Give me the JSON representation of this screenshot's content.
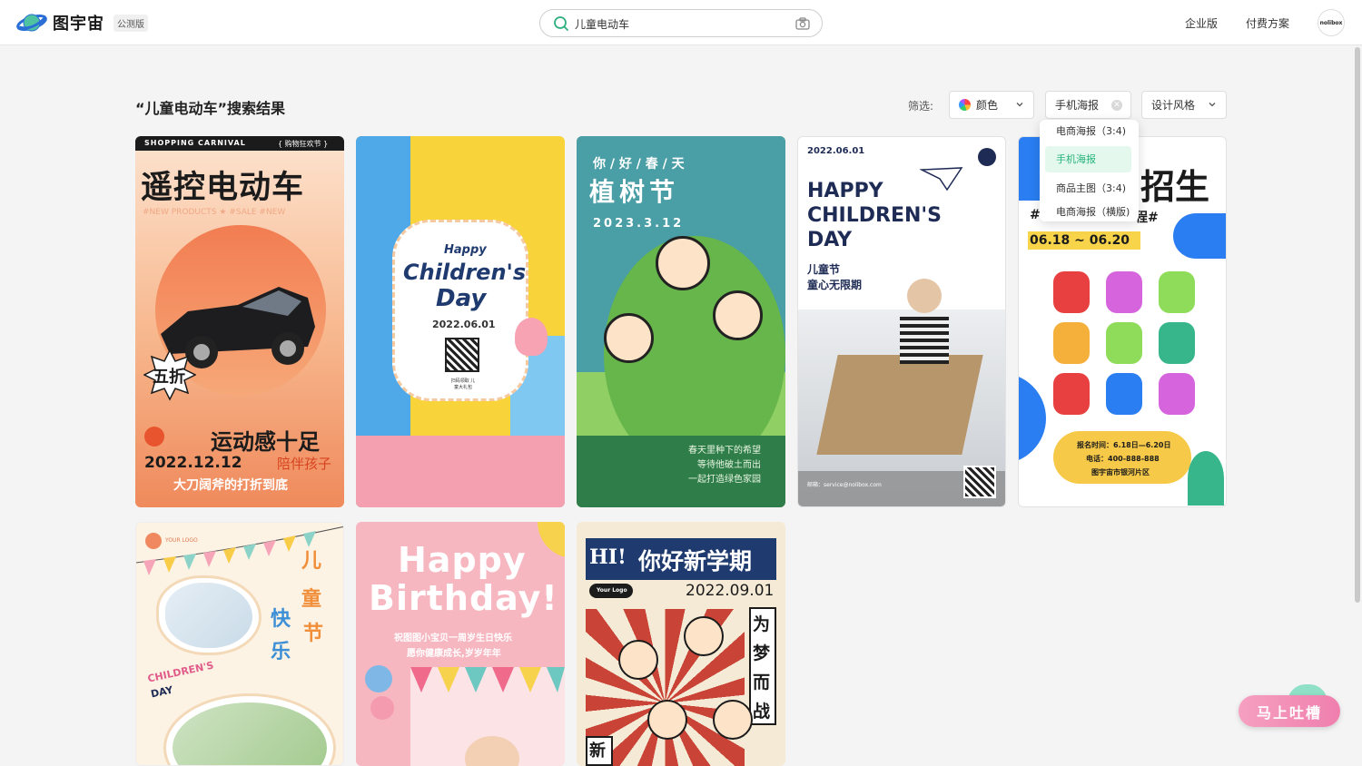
{
  "header": {
    "brand": "图宇宙",
    "beta_badge": "公测版",
    "search_value": "儿童电动车",
    "nav": [
      "企业版",
      "付费方案"
    ],
    "avatar_text": "nolibox"
  },
  "results": {
    "title": "“儿童电动车”搜索结果",
    "filter_label": "筛选:",
    "filters": {
      "color": "颜色",
      "size": "手机海报",
      "style": "设计风格"
    },
    "size_options": [
      "电商海报（3:4)",
      "手机海报",
      "商品主图（3:4)",
      "电商海报（横版)"
    ],
    "selected_size_index": 1
  },
  "cards": [
    {
      "top_left": "SHOPPING CARNIVAL",
      "top_right": "{ 购物狂欢节 }",
      "title": "遥控电动车",
      "sub": "#NEW PRODUCTS ★ #SALE   #NEW",
      "badge": "五折",
      "slogan": "运动感十足",
      "date": "2022.12.12",
      "tag": "陪伴孩子",
      "bottom": "大刀阔斧的打折到底"
    },
    {
      "happy": "Happy",
      "title1": "Children's",
      "title2": "Day",
      "date": "2022.06.01",
      "qr_caption": "扫码领取 儿童大礼包"
    },
    {
      "title_top": "你 / 好 / 春 / 天",
      "title": "植树节",
      "date": "2023.3.12",
      "lines": [
        "春天里种下的希望",
        "等待他破土而出",
        "一起打造绿色家园"
      ]
    },
    {
      "date": "2022.06.01",
      "title": [
        "HAPPY",
        "CHILDREN'S",
        "DAY"
      ],
      "cn1": "儿童节",
      "cn2": "童心无限期",
      "footer": "邮箱：service@nolibox.com"
    },
    {
      "title": "招生",
      "hashtag_left": "#",
      "hashtag_right": "程#",
      "date": "06.18 ~ 06.20",
      "info": [
        "报名时间：6.18日—6.20日",
        "电话：400-888-888",
        "图宇宙市银河片区"
      ]
    },
    {
      "logo": "YOUR LOGO",
      "cn_right": [
        "儿",
        "童"
      ],
      "cn_left": [
        "快",
        "乐"
      ],
      "cn_mid": "节",
      "en": "CHILDREN'S",
      "en2": "DAY"
    },
    {
      "title1": "Happy",
      "title2": "Birthday!",
      "line1": "祝图图小宝贝一周岁生日快乐",
      "line2": "愿你健康成长,岁岁年年"
    },
    {
      "hi": "HI!",
      "title": "你好新学期",
      "logo": "Your Logo",
      "date": "2022.09.01",
      "vertical": [
        "为",
        "梦",
        "而",
        "战"
      ],
      "corner": "新"
    }
  ],
  "feedback": "马上吐槽",
  "colors": {
    "accent": "#26b37a",
    "feedback": "#ef7fae"
  }
}
